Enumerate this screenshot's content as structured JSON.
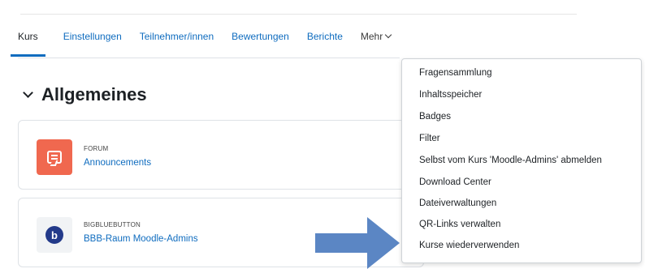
{
  "tabs": [
    {
      "label": "Kurs",
      "active": true
    },
    {
      "label": "Einstellungen"
    },
    {
      "label": "Teilnehmer/innen"
    },
    {
      "label": "Bewertungen"
    },
    {
      "label": "Berichte"
    },
    {
      "label": "Mehr"
    }
  ],
  "section": {
    "title": "Allgemeines"
  },
  "activities": [
    {
      "type": "FORUM",
      "name": "Announcements",
      "icon": "forum-icon",
      "icon_color": "#f0684f"
    },
    {
      "type": "BIGBLUEBUTTON",
      "name": "BBB-Raum Moodle-Admins",
      "icon": "bigbluebutton-icon",
      "icon_color": "#233a8a",
      "icon_letter": "b"
    }
  ],
  "more_menu": {
    "items": [
      "Fragensammlung",
      "Inhaltsspeicher",
      "Badges",
      "Filter",
      "Selbst vom Kurs 'Moodle-Admins' abmelden",
      "Download Center",
      "Dateiverwaltungen",
      "QR-Links verwalten",
      "Kurse wiederverwenden"
    ]
  },
  "colors": {
    "link": "#0f6cbf",
    "arrow": "#5b86c4",
    "text": "#1d2125"
  }
}
